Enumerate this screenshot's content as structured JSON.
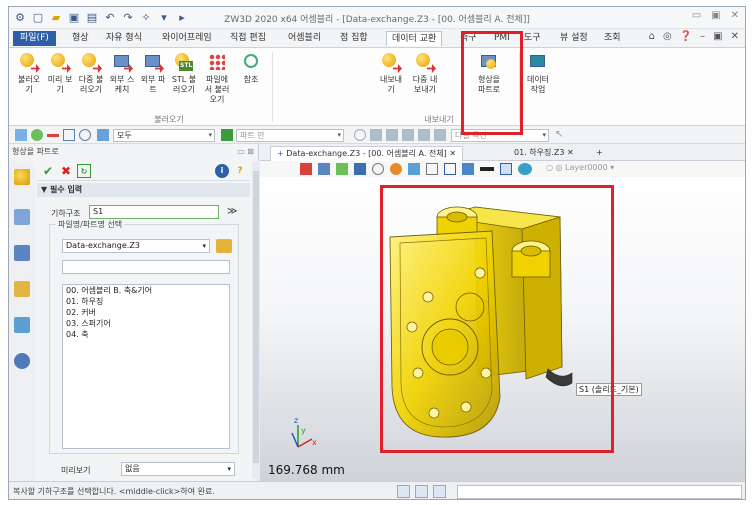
{
  "window": {
    "title": "ZW3D 2020 x64   어셈블리 - [Data-exchange.Z3 - [00. 어셈블리 A. 전체]]"
  },
  "menu": {
    "file": "파일(F)",
    "tabs": [
      "형상",
      "자유 형식",
      "와이어프레임",
      "직접 편집",
      "어셈블리",
      "점 집합",
      "데이터 교환",
      "측구",
      "PMI",
      "도구",
      "뷰 설정",
      "조회"
    ]
  },
  "ribbon": {
    "import_buttons": [
      {
        "label": "불러오기",
        "icon": "import-icon"
      },
      {
        "label": "미리 보기",
        "icon": "preview-icon"
      },
      {
        "label": "다중 불러오기",
        "icon": "multi-import-icon"
      },
      {
        "label": "외부 스케치",
        "icon": "external-sketch-icon"
      },
      {
        "label": "외부 파트",
        "icon": "external-part-icon"
      },
      {
        "label": "STL 불러오기",
        "icon": "stl-import-icon"
      },
      {
        "label": "파일에서 불러오기",
        "icon": "import-from-file-icon"
      },
      {
        "label": "참조",
        "icon": "reference-icon"
      }
    ],
    "import_group": "불러오기",
    "export_buttons": [
      {
        "label": "내보내기",
        "icon": "export-icon"
      },
      {
        "label": "다중 내보내기",
        "icon": "multi-export-icon"
      },
      {
        "label": "형상을 파트로",
        "icon": "shape-to-part-icon"
      }
    ],
    "export_group": "내보내기",
    "data_button": {
      "label": "데이터 작업",
      "icon": "data-work-icon"
    }
  },
  "toolbar2": {
    "filter_value": "모두",
    "part_combo": "파트 만",
    "last_combo": "다일 곡선"
  },
  "left_panel": {
    "title": "형상을 파트로",
    "section": "필수 입력",
    "geometry_label": "기하구조",
    "geometry_value": "S1",
    "file_group_title": "파일명/파트명 선택",
    "file_value": "Data-exchange.Z3",
    "list_items": [
      "00. 어셈블리 B. 축&기어",
      "01. 하우징",
      "02. 커버",
      "03. 스퍼기어",
      "04. 축"
    ],
    "preview_label": "미리보기",
    "preview_value": "없음"
  },
  "viewport": {
    "tabs": [
      {
        "label": "Data-exchange.Z3 - [00. 어셈블리 A. 전체]",
        "active": true
      },
      {
        "label": "01. 하우징.Z3",
        "active": false
      }
    ],
    "layer": "Layer0000",
    "scale": "169.768 mm",
    "label_s1": "S1 (솔리드_기본)"
  },
  "status": {
    "message": "복사할 기하구조를 선택합니다. <middle-click>하여 완료."
  },
  "colors": {
    "accent": "#2f5fa7",
    "highlight": "#e0202a",
    "part": "#e6cc00"
  }
}
